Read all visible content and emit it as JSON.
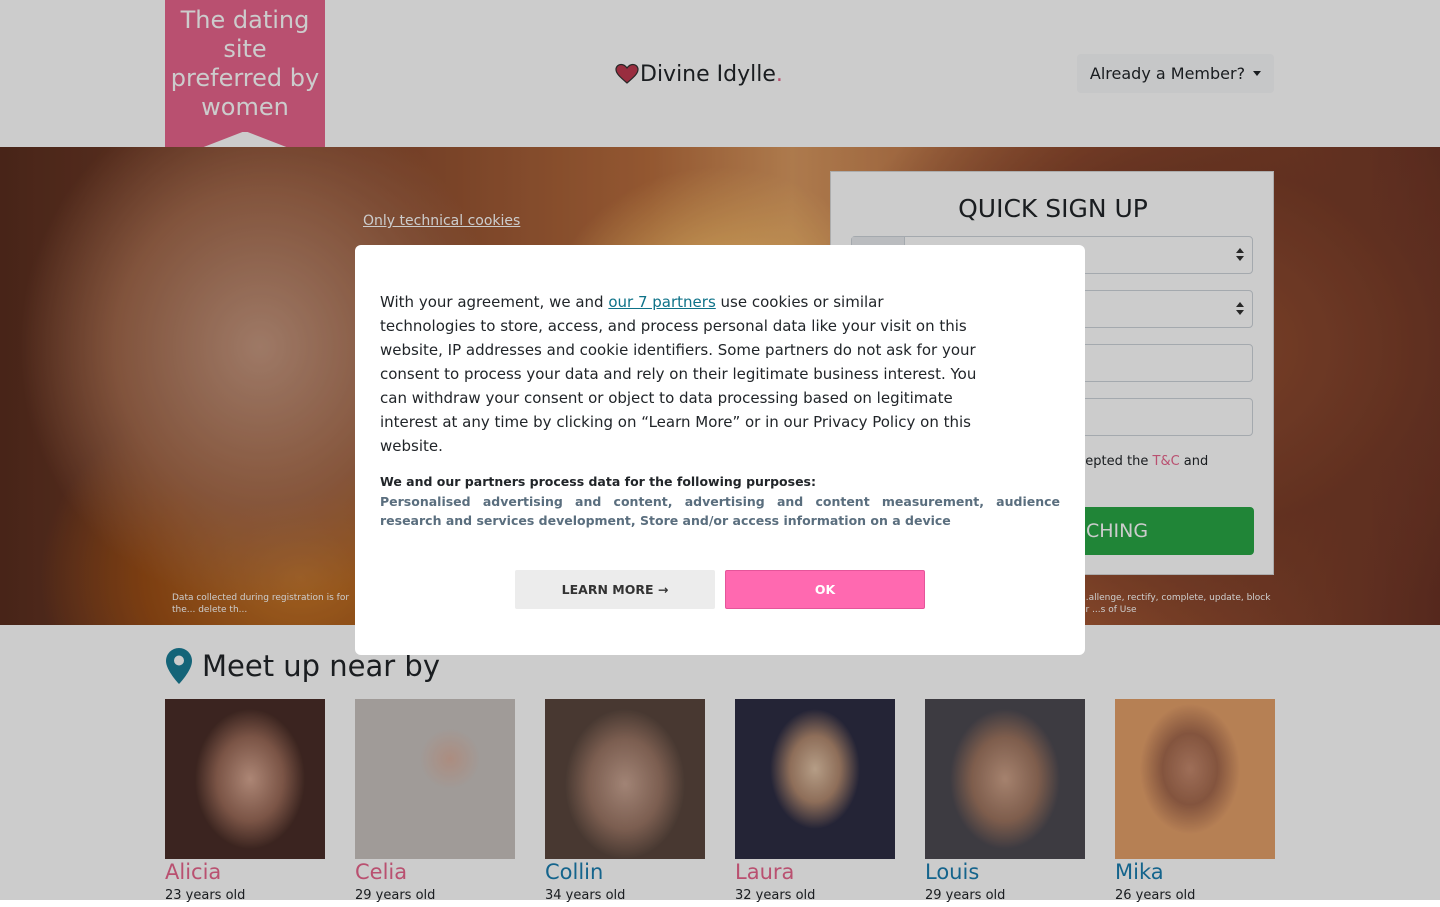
{
  "header": {
    "tagline": "The dating site preferred by women",
    "brand_name": "Divine Idylle",
    "brand_dot": ".",
    "member_button": "Already a Member?"
  },
  "hero": {
    "only_technical_cookies": "Only technical cookies",
    "disclaimer_left": "Data collected during registration is for the... delete th...",
    "disclaimer_right": "...allenge, rectify, complete, update, block or ...s of Use",
    "signup": {
      "title": "QUICK SIGN UP",
      "terms_prefix": "ccepted the ",
      "terms_link": "T&C",
      "terms_suffix": " and",
      "cta": "CHING"
    }
  },
  "meet": {
    "title": "Meet up near by",
    "profiles": [
      {
        "name": "Alicia",
        "age": "23 years old",
        "gender": "female"
      },
      {
        "name": "Celia",
        "age": "29 years old",
        "gender": "female"
      },
      {
        "name": "Collin",
        "age": "34 years old",
        "gender": "male"
      },
      {
        "name": "Laura",
        "age": "32 years old",
        "gender": "female"
      },
      {
        "name": "Louis",
        "age": "29 years old",
        "gender": "male"
      },
      {
        "name": "Mika",
        "age": "26 years old",
        "gender": "male"
      }
    ]
  },
  "consent": {
    "intro_before": "With your agreement, we and ",
    "partners_link": "our 7 partners",
    "intro_after": " use cookies or similar technologies to store, access, and process personal data like your visit on this website, IP addresses and cookie identifiers. Some partners do not ask for your consent to process your data and rely on their legitimate business interest. You can withdraw your consent or object to data processing based on legitimate interest at any time by clicking on “Learn More” or in our Privacy Policy on this website.",
    "purposes_heading": "We and our partners process data for the following purposes:",
    "purposes": "Personalised advertising and content, advertising and content measurement, audience research and services development, Store and/or access information on a device",
    "learn_more": "LEARN MORE →",
    "ok": "OK"
  },
  "colors": {
    "brand_pink": "#e8658c",
    "male_blue": "#1a7db0",
    "ok_button": "#ff69b0",
    "cta_green": "#28a745",
    "pin_teal": "#1a7d96"
  }
}
